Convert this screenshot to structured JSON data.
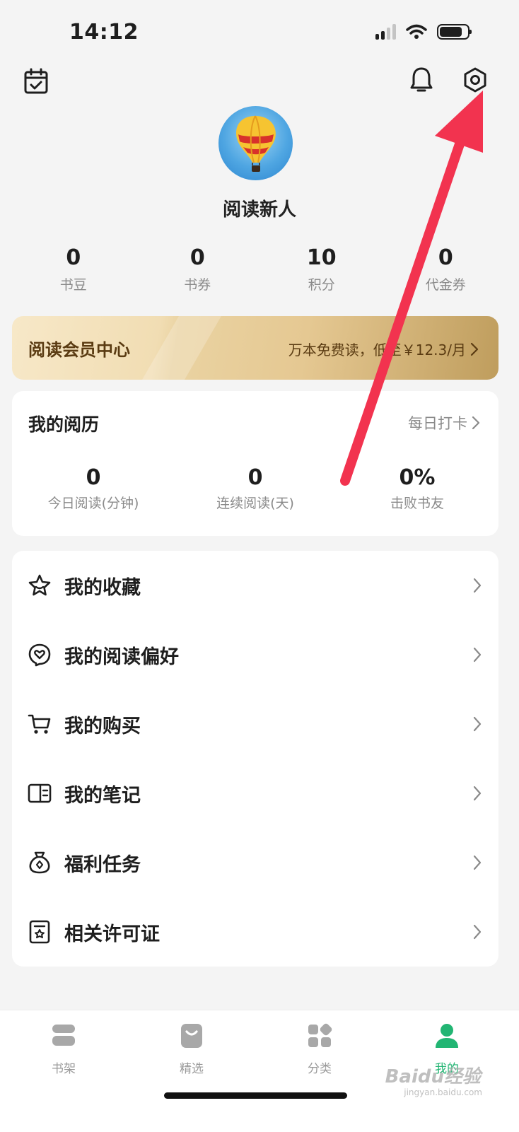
{
  "status_bar": {
    "time": "14:12"
  },
  "profile": {
    "nickname": "阅读新人"
  },
  "stats": [
    {
      "value": "0",
      "label": "书豆"
    },
    {
      "value": "0",
      "label": "书券"
    },
    {
      "value": "10",
      "label": "积分"
    },
    {
      "value": "0",
      "label": "代金券"
    }
  ],
  "vip": {
    "title": "阅读会员中心",
    "promo": "万本免费读，低至￥12.3/月"
  },
  "reading": {
    "title": "我的阅历",
    "checkin": "每日打卡",
    "stats": [
      {
        "value": "0",
        "label": "今日阅读(分钟)"
      },
      {
        "value": "0",
        "label": "连续阅读(天)"
      },
      {
        "value": "0%",
        "label": "击败书友"
      }
    ]
  },
  "menu": [
    {
      "label": "我的收藏",
      "icon": "star-icon"
    },
    {
      "label": "我的阅读偏好",
      "icon": "heart-bubble-icon"
    },
    {
      "label": "我的购买",
      "icon": "cart-icon"
    },
    {
      "label": "我的笔记",
      "icon": "notebook-icon"
    },
    {
      "label": "福利任务",
      "icon": "reward-bag-icon"
    },
    {
      "label": "相关许可证",
      "icon": "license-icon"
    }
  ],
  "tabs": [
    {
      "label": "书架",
      "icon": "bookshelf-icon"
    },
    {
      "label": "精选",
      "icon": "shopping-bag-icon"
    },
    {
      "label": "分类",
      "icon": "category-grid-icon"
    },
    {
      "label": "我的",
      "icon": "user-icon",
      "active": true
    }
  ],
  "watermark": {
    "brand": "Baidu经验",
    "site": "jingyan.baidu.com"
  },
  "colors": {
    "accent": "#22b573",
    "annotation_arrow": "#f2334f",
    "vip_text": "#5a3b12"
  }
}
